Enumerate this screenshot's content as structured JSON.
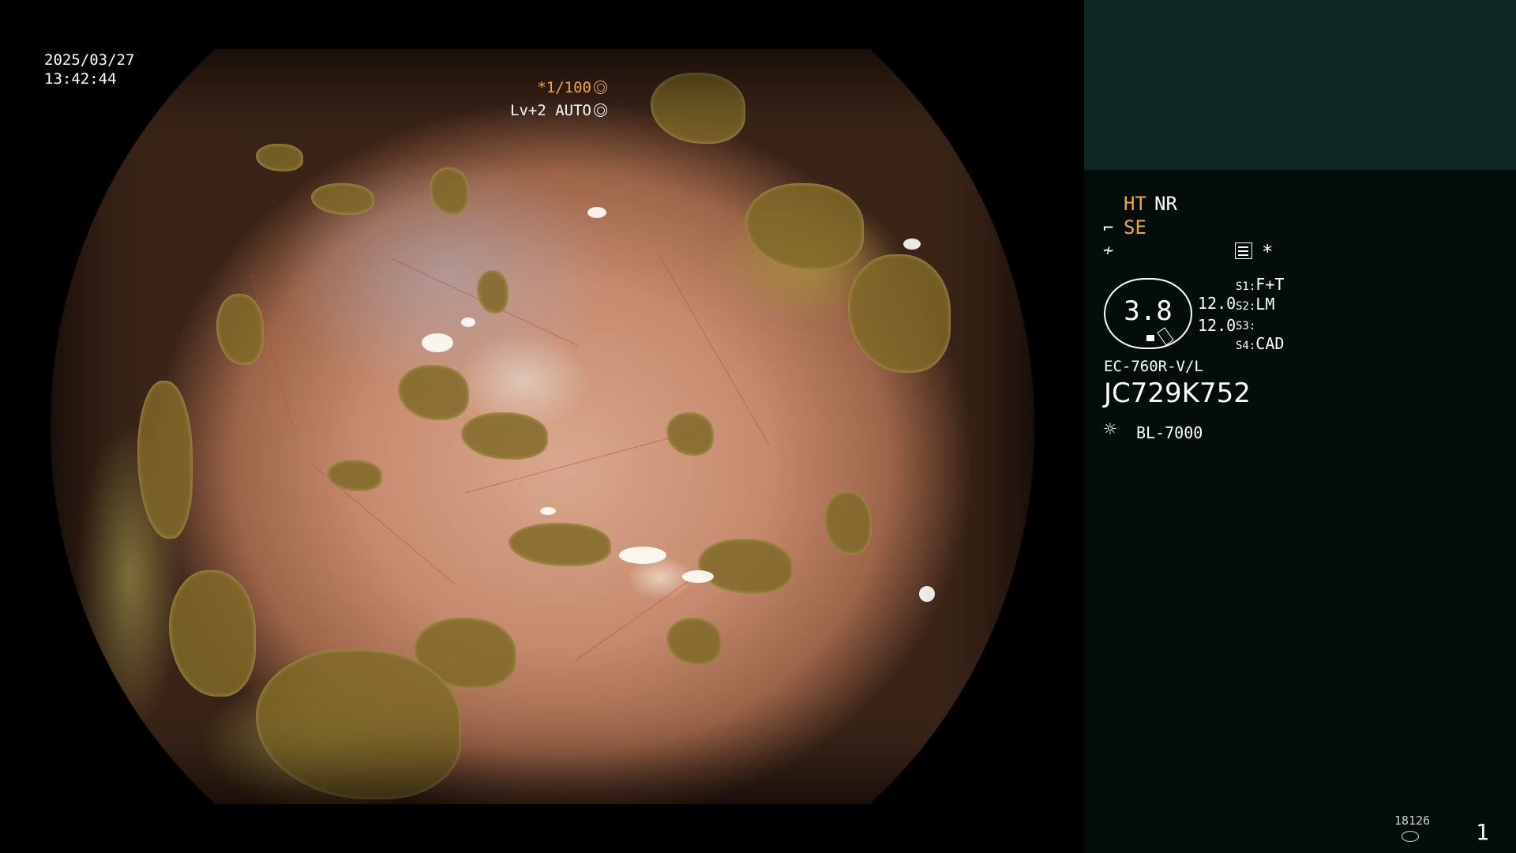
{
  "overlay": {
    "date": "2025/03/27",
    "time": "13:42:44",
    "shutter": "*1/100",
    "level": "Lv+2 AUTO"
  },
  "panel": {
    "ht": "HT",
    "nr": "NR",
    "se": "SE",
    "star": "*",
    "gauge_value": "3.8",
    "num_1": "12.0",
    "num_2": "12.0",
    "switches": [
      {
        "key": "S1:",
        "value": "F+T"
      },
      {
        "key": "S2:",
        "value": "LM"
      },
      {
        "key": "S3:",
        "value": ""
      },
      {
        "key": "S4:",
        "value": "CAD"
      }
    ],
    "scope_model": "EC-760R-V/L",
    "scope_serial": "JC729K752",
    "light_source": "BL-7000",
    "storage_count": "18126",
    "page_number": "1"
  },
  "colors": {
    "accent_amber": "#f0a830",
    "panel_bg": "#030e0c",
    "thumb_bg": "#0e2623"
  },
  "icons": [
    "shutter-icon",
    "iris-icon",
    "scope-tip-icon",
    "curve-icon",
    "settings-list-icon",
    "lamp-icon",
    "storage-icon"
  ]
}
